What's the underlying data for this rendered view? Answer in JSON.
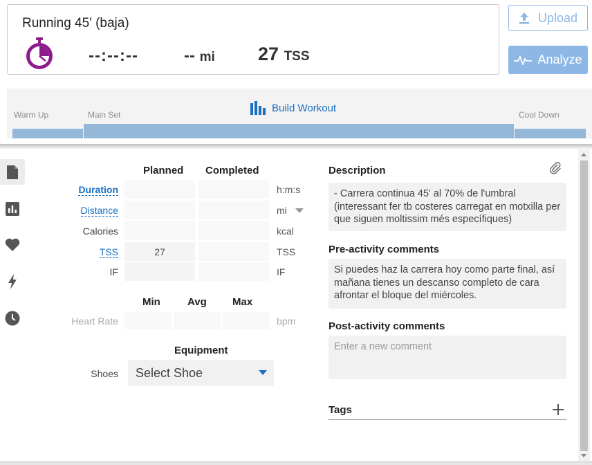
{
  "workout": {
    "title": "Running 45' (baja)",
    "duration": "--:--:--",
    "distance_value": "--",
    "distance_unit": "mi",
    "tss_value": "27",
    "tss_unit": "TSS"
  },
  "actions": {
    "upload_label": "Upload",
    "analyze_label": "Analyze"
  },
  "structure": {
    "build_label": "Build Workout",
    "segments": [
      "Warm Up",
      "Main Set",
      "Cool Down"
    ]
  },
  "table": {
    "headers": {
      "planned": "Planned",
      "completed": "Completed"
    },
    "rows": [
      {
        "label": "Duration",
        "planned": "",
        "completed": "",
        "unit": "h:m:s"
      },
      {
        "label": "Distance",
        "planned": "",
        "completed": "",
        "unit": "mi"
      },
      {
        "label": "Calories",
        "planned": "",
        "completed": "",
        "unit": "kcal"
      },
      {
        "label": "TSS",
        "planned": "27",
        "completed": "",
        "unit": "TSS"
      },
      {
        "label": "IF",
        "planned": "",
        "completed": "",
        "unit": "IF"
      }
    ],
    "hr_headers": {
      "min": "Min",
      "avg": "Avg",
      "max": "Max"
    },
    "hr_label": "Heart Rate",
    "hr_unit": "bpm"
  },
  "equipment": {
    "title": "Equipment",
    "shoes_label": "Shoes",
    "shoes_value": "Select Shoe"
  },
  "description": {
    "title": "Description",
    "text": "- Carrera continua 45' al 70% de l'umbral (interessant fer tb costeres carregat en motxilla per que siguen moltissim més específiques)"
  },
  "pre_comments": {
    "title": "Pre-activity comments",
    "text": "Si puedes haz la carrera hoy como parte final, así mañana tienes un descanso completo de cara afrontar el bloque del miércoles."
  },
  "post_comments": {
    "title": "Post-activity comments",
    "placeholder": "Enter a new comment"
  },
  "tags": {
    "title": "Tags"
  },
  "colors": {
    "accent": "#1a6fc2",
    "button_light": "#8db8e6",
    "structure_bar": "#95b8d9",
    "timer_icon": "#8e1b8c"
  }
}
